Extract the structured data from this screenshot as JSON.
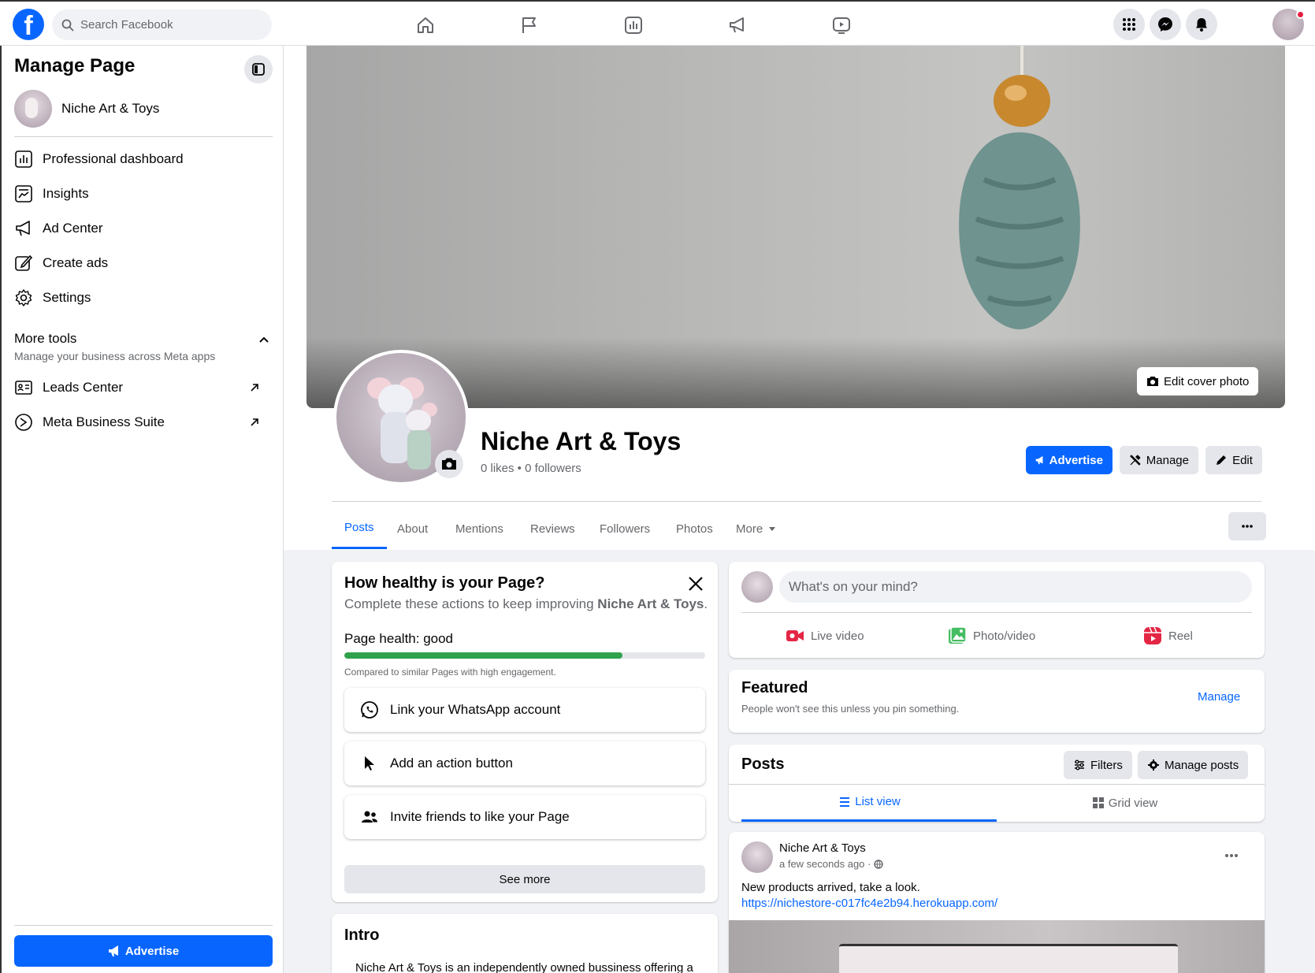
{
  "topbar": {
    "logo": "f",
    "search_placeholder": "Search Facebook",
    "nav_icons": [
      "home-icon",
      "flag-icon",
      "insights-icon",
      "megaphone-icon",
      "video-icon"
    ],
    "right_icons": [
      "menu-grid-icon",
      "messenger-icon",
      "bell-icon"
    ]
  },
  "sidebar": {
    "title": "Manage Page",
    "page_name": "Niche Art & Toys",
    "items": [
      {
        "label": "Professional dashboard",
        "icon": "dashboard-icon"
      },
      {
        "label": "Insights",
        "icon": "insights-icon"
      },
      {
        "label": "Ad Center",
        "icon": "megaphone-icon"
      },
      {
        "label": "Create ads",
        "icon": "pencil-icon"
      },
      {
        "label": "Settings",
        "icon": "gear-icon"
      }
    ],
    "more_tools": {
      "title": "More tools",
      "subtitle": "Manage your business across Meta apps"
    },
    "tools": [
      {
        "label": "Leads Center",
        "icon": "leads-icon"
      },
      {
        "label": "Meta Business Suite",
        "icon": "meta-suite-icon"
      }
    ],
    "advertise_label": "Advertise"
  },
  "cover": {
    "edit_label": "Edit cover photo"
  },
  "page": {
    "name": "Niche Art & Toys",
    "stats": "0 likes • 0 followers",
    "buttons": {
      "advertise": "Advertise",
      "manage": "Manage",
      "edit": "Edit"
    }
  },
  "tabs": [
    {
      "label": "Posts",
      "active": true
    },
    {
      "label": "About"
    },
    {
      "label": "Mentions"
    },
    {
      "label": "Reviews"
    },
    {
      "label": "Followers"
    },
    {
      "label": "Photos"
    },
    {
      "label": "More"
    }
  ],
  "health": {
    "title": "How healthy is your Page?",
    "subtitle_prefix": "Complete these actions to keep improving ",
    "subtitle_page": "Niche Art & Toys",
    "subtitle_suffix": ".",
    "status": "Page health: good",
    "progress": 0.77,
    "compared": "Compared to similar Pages with high engagement.",
    "actions": [
      {
        "label": "Link your WhatsApp account",
        "icon": "whatsapp-icon"
      },
      {
        "label": "Add an action button",
        "icon": "cursor-icon"
      },
      {
        "label": "Invite friends to like your Page",
        "icon": "people-icon"
      }
    ],
    "see_more": "See more"
  },
  "intro": {
    "title": "Intro",
    "text": "Niche Art & Toys is an independently owned bussiness offering a"
  },
  "composer": {
    "placeholder": "What's on your mind?",
    "actions": [
      {
        "label": "Live video",
        "icon": "live-video-icon",
        "color": "#e42645"
      },
      {
        "label": "Photo/video",
        "icon": "photo-icon",
        "color": "#45bd62"
      },
      {
        "label": "Reel",
        "icon": "reel-icon",
        "color": "#e42645"
      }
    ]
  },
  "featured": {
    "title": "Featured",
    "subtitle": "People won't see this unless you pin something.",
    "manage": "Manage"
  },
  "posts": {
    "title": "Posts",
    "filters": "Filters",
    "manage_posts": "Manage posts",
    "list_view": "List view",
    "grid_view": "Grid view"
  },
  "post": {
    "author": "Niche Art & Toys",
    "time": "a few seconds ago ·",
    "text": "New products arrived, take a look.",
    "link": "https://nichestore-c017fc4e2b94.herokuapp.com/"
  },
  "colors": {
    "accent": "#0866ff",
    "health_bar": "#31a24c"
  }
}
